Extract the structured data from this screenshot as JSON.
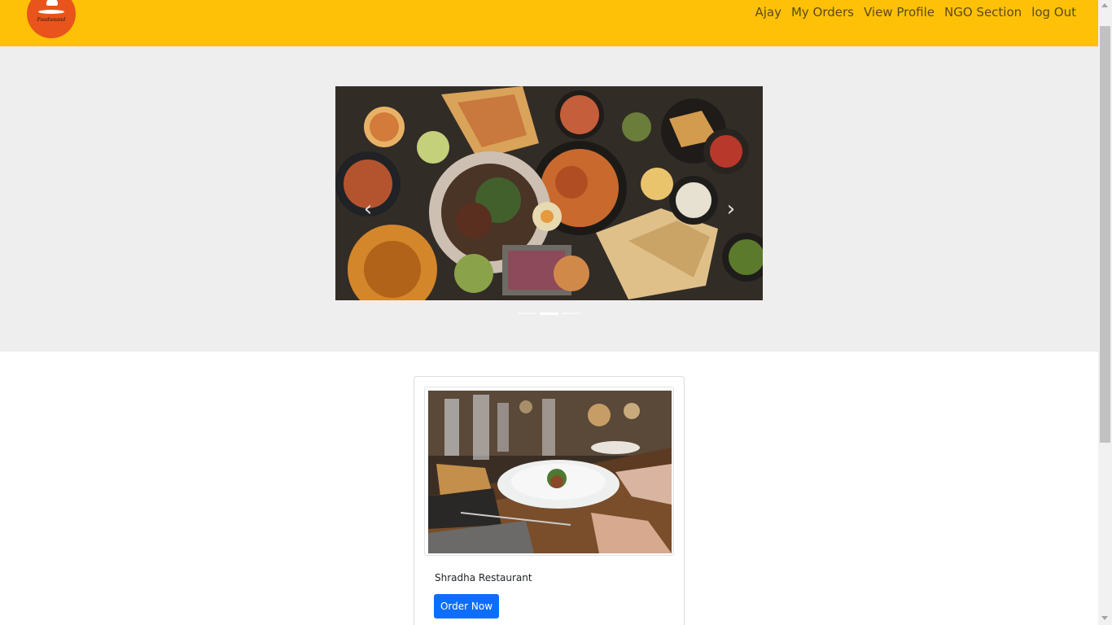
{
  "navbar": {
    "logo_text": "Foodiesand",
    "links": [
      "Ajay",
      "My Orders",
      "View Profile",
      "NGO Section",
      "log Out"
    ],
    "background": "#ffc107"
  },
  "carousel": {
    "image": "indian-food-spread-photo",
    "prev_icon": "chevron-left-icon",
    "next_icon": "chevron-right-icon",
    "prev_glyph": "‹",
    "next_glyph": "›",
    "slide_count": 3,
    "active_slide": 2
  },
  "restaurants": [
    {
      "name": "Shradha Restaurant",
      "image": "restaurant-dining-table-photo",
      "button_label": "Order Now"
    }
  ],
  "colors": {
    "hero_background": "#eeeeee",
    "button": "#0d6efd"
  }
}
